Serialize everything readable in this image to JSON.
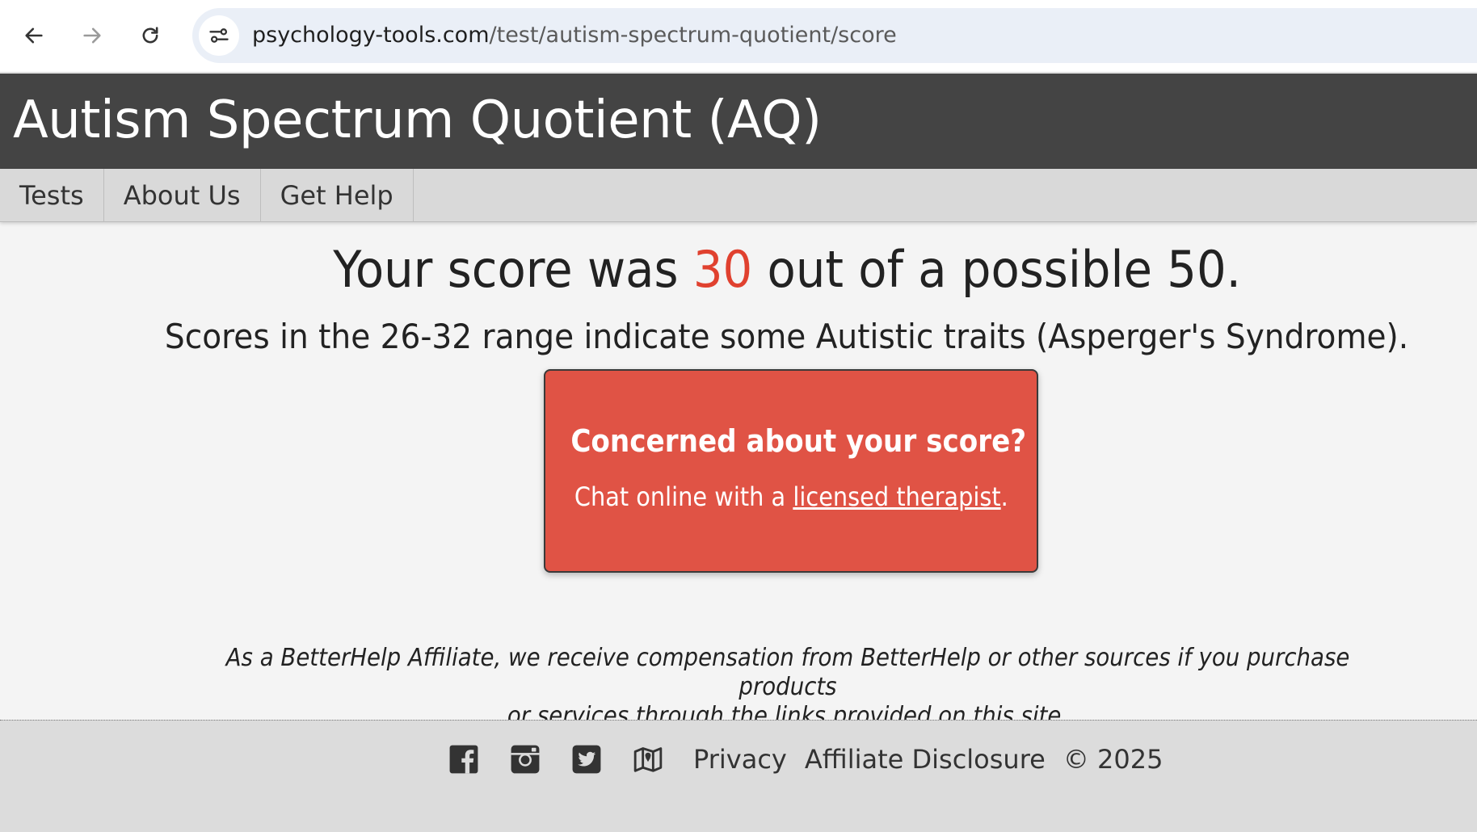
{
  "browser": {
    "url_host": "psychology-tools.com",
    "url_path": "/test/autism-spectrum-quotient/score",
    "icons": [
      "back-arrow-icon",
      "forward-arrow-icon",
      "reload-icon",
      "site-info-icon"
    ]
  },
  "header": {
    "title": "Autism Spectrum Quotient (AQ)"
  },
  "nav": {
    "items": [
      {
        "label": "Tests"
      },
      {
        "label": "About Us"
      },
      {
        "label": "Get Help"
      }
    ]
  },
  "result": {
    "prefix": "Your score was ",
    "score": "30",
    "suffix": " out of a possible 50.",
    "range_text": "Scores in the 26-32 range indicate some Autistic traits (Asperger's Syndrome)."
  },
  "cta": {
    "heading": "Concerned about your score?",
    "text_prefix": "Chat online with a ",
    "link_label": "licensed therapist",
    "text_suffix": "."
  },
  "disclaimer": {
    "line1": "As a BetterHelp Affiliate, we receive compensation from BetterHelp or other sources if you purchase products",
    "line2": "or services through the links provided on this site."
  },
  "footer": {
    "icons": [
      "facebook-icon",
      "instagram-icon",
      "twitter-icon",
      "map-icon"
    ],
    "privacy_label": "Privacy",
    "affiliate_label": "Affiliate Disclosure",
    "copyright": "© 2025"
  },
  "colors": {
    "header_bg": "#444444",
    "nav_bg": "#d9d9d9",
    "score_accent": "#e0412f",
    "cta_bg": "#e05345",
    "footer_bg": "#dcdcdc"
  }
}
